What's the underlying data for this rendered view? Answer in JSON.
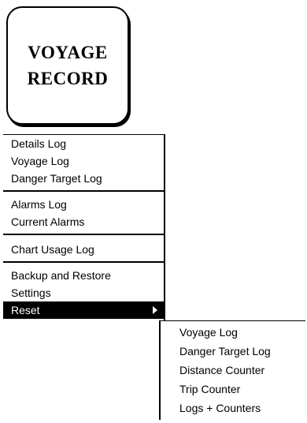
{
  "title_button": {
    "line1": "VOYAGE",
    "line2": "RECORD"
  },
  "main_menu": {
    "items": [
      {
        "label": "Details Log"
      },
      {
        "label": "Voyage Log"
      },
      {
        "label": "Danger Target Log"
      },
      {
        "label": "Alarms Log"
      },
      {
        "label": "Current Alarms"
      },
      {
        "label": "Chart Usage Log"
      },
      {
        "label": "Backup and Restore"
      },
      {
        "label": "Settings"
      },
      {
        "label": "Reset",
        "selected": true,
        "has_submenu": true
      }
    ]
  },
  "reset_submenu": {
    "items": [
      {
        "label": "Voyage Log"
      },
      {
        "label": "Danger Target Log"
      },
      {
        "label": "Distance Counter"
      },
      {
        "label": "Trip Counter"
      },
      {
        "label": "Logs + Counters"
      }
    ]
  },
  "colors": {
    "background": "#ffffff",
    "foreground": "#000000",
    "selected_background": "#000000",
    "selected_text": "#ffffff"
  },
  "icons": {
    "submenu_indicator": "triangle-right-icon"
  }
}
